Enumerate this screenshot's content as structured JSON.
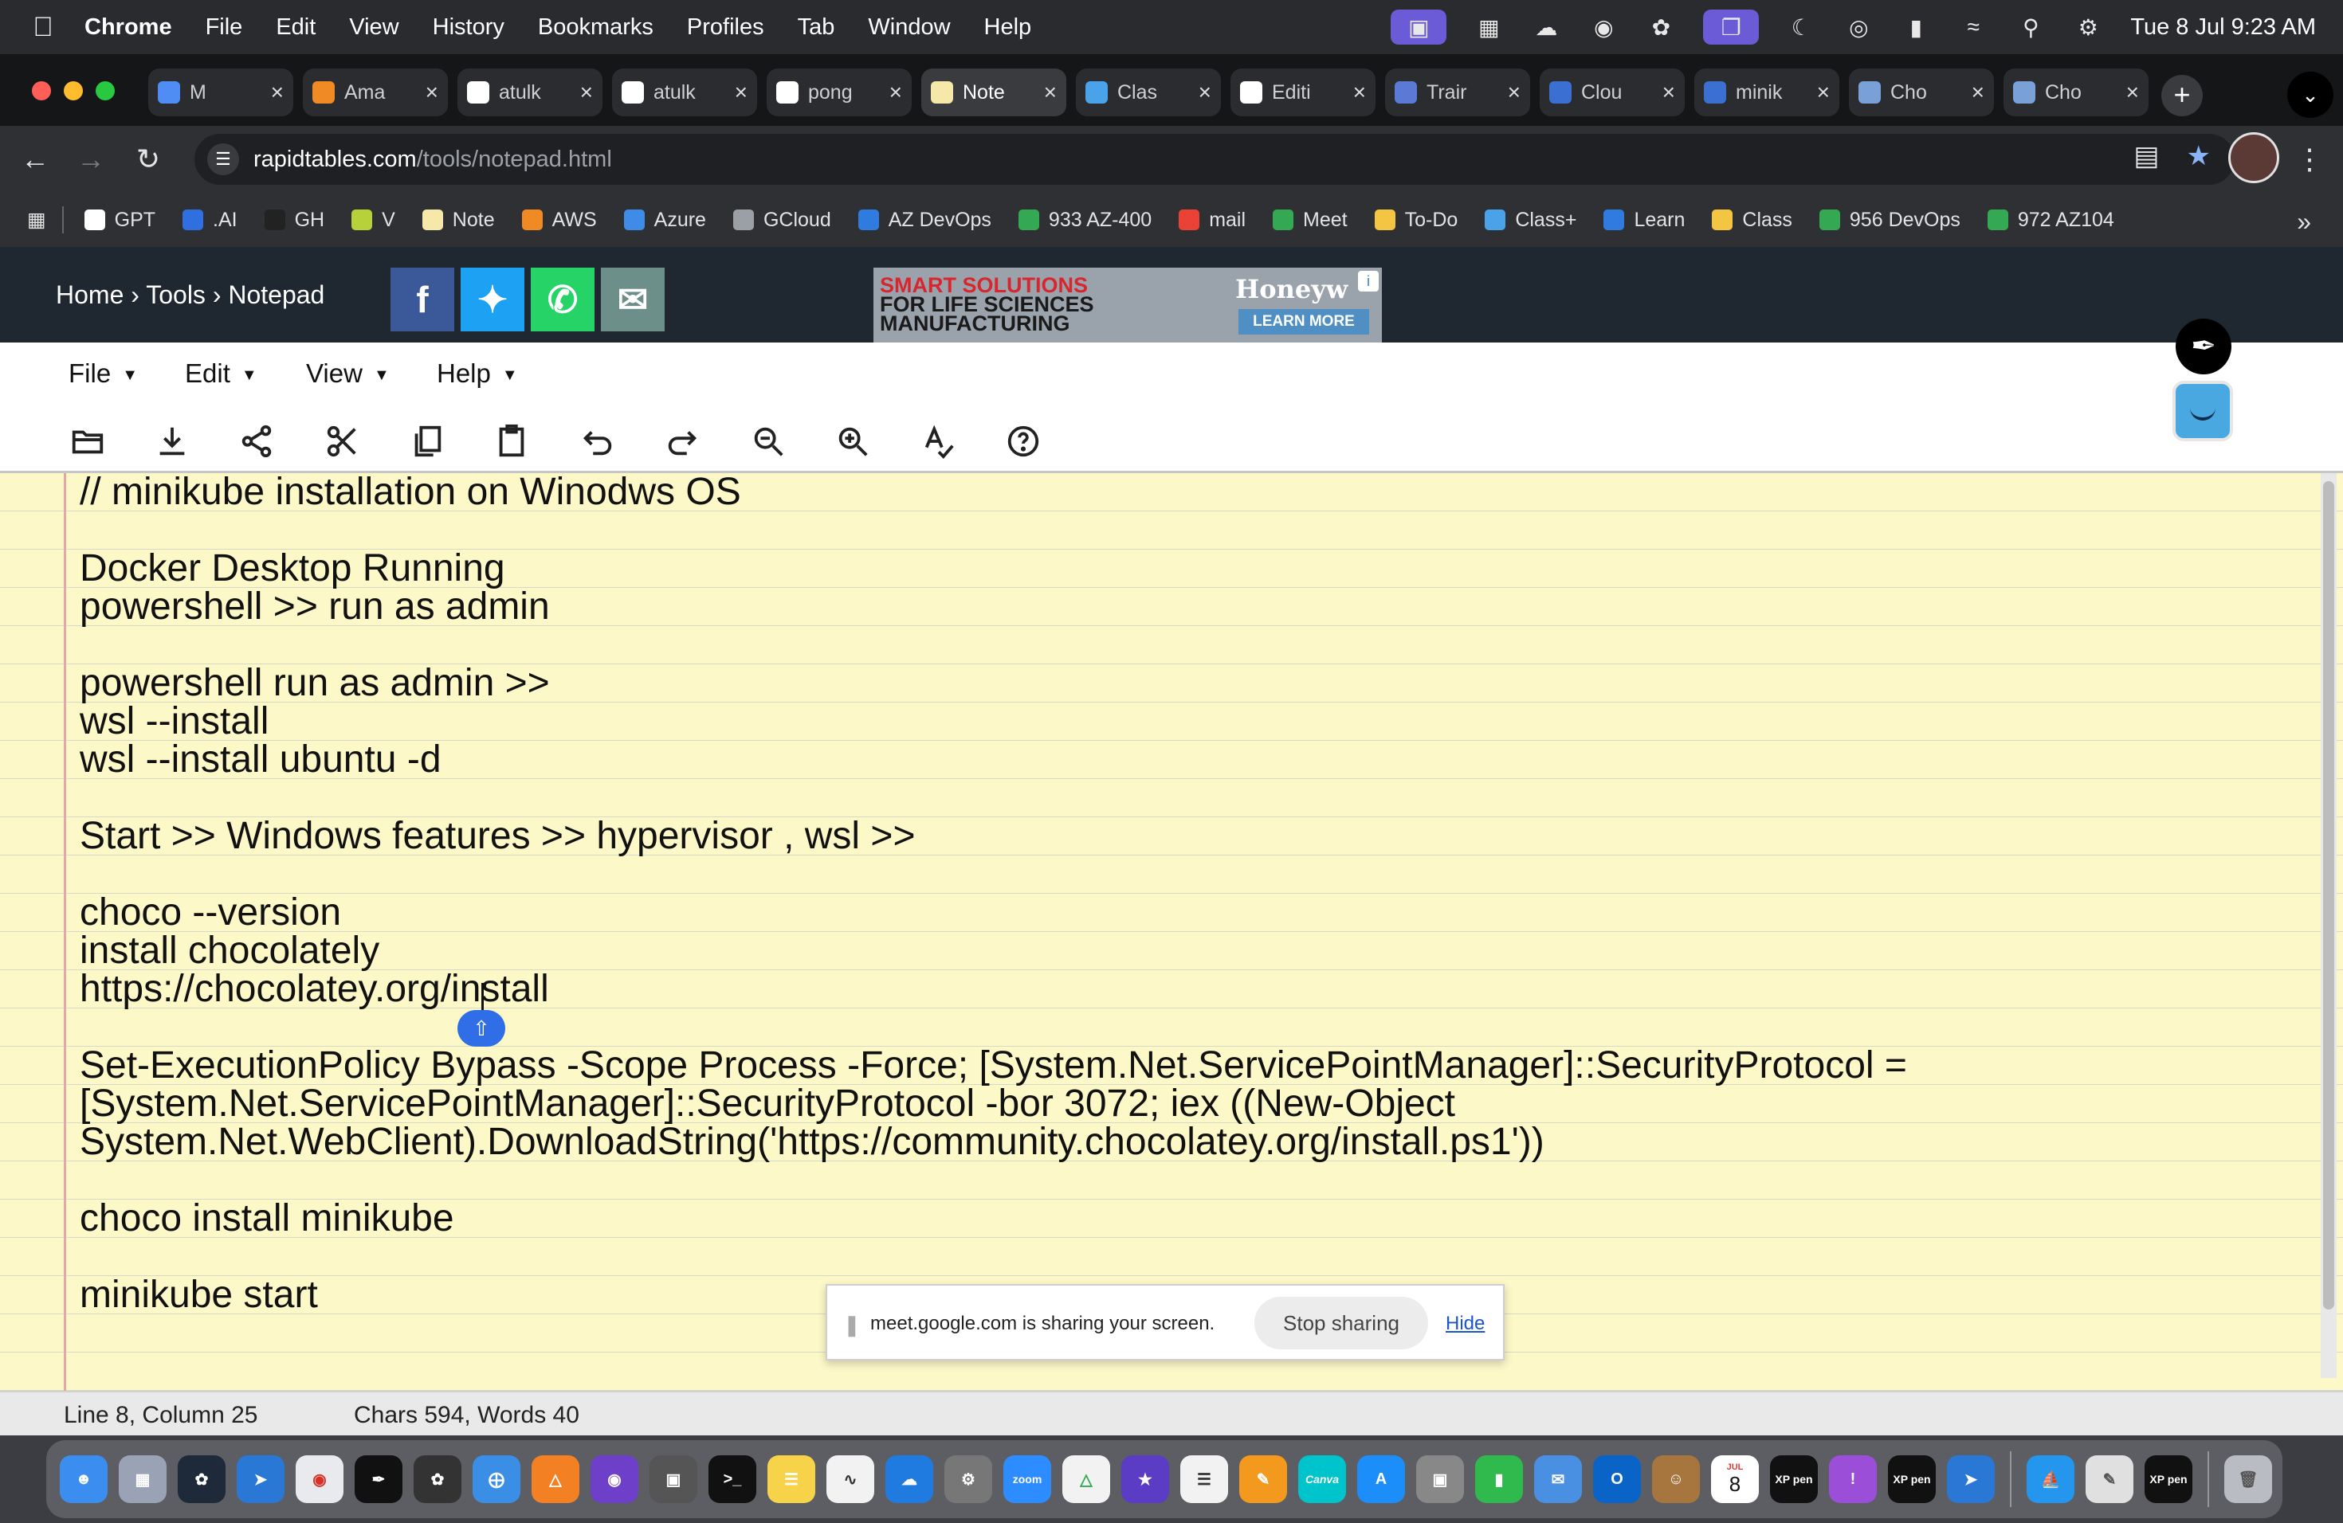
{
  "menubar": {
    "items": [
      "Chrome",
      "File",
      "Edit",
      "View",
      "History",
      "Bookmarks",
      "Profiles",
      "Tab",
      "Window",
      "Help"
    ],
    "clock": "Tue 8 Jul  9:23 AM"
  },
  "tabs": [
    {
      "label": "M",
      "color": "#4f8df5"
    },
    {
      "label": "Ama",
      "color": "#f08a24"
    },
    {
      "label": "atulk",
      "color": "#ffffff"
    },
    {
      "label": "atulk",
      "color": "#ffffff"
    },
    {
      "label": "pong",
      "color": "#ffffff"
    },
    {
      "label": "Note",
      "color": "#f5e8a8"
    },
    {
      "label": "Clas",
      "color": "#4aa3e8"
    },
    {
      "label": "Editi",
      "color": "#ffffff"
    },
    {
      "label": "Trair",
      "color": "#5a7ad6"
    },
    {
      "label": "Clou",
      "color": "#3b6fd1"
    },
    {
      "label": "minik",
      "color": "#3b6fd1"
    },
    {
      "label": "Cho",
      "color": "#7aa0d8"
    },
    {
      "label": "Cho",
      "color": "#7aa0d8"
    }
  ],
  "omnibox": {
    "domain": "rapidtables.com",
    "path": "/tools/notepad.html"
  },
  "bookmarks": [
    {
      "label": "GPT",
      "color": "#ffffff"
    },
    {
      "label": ".AI",
      "color": "#2f6fe0"
    },
    {
      "label": "GH",
      "color": "#222222"
    },
    {
      "label": "V",
      "color": "#b6d13a"
    },
    {
      "label": "Note",
      "color": "#f5e8a8"
    },
    {
      "label": "AWS",
      "color": "#f08a24"
    },
    {
      "label": "Azure",
      "color": "#3f8ce8"
    },
    {
      "label": "GCloud",
      "color": "#9aa0a6"
    },
    {
      "label": "AZ DevOps",
      "color": "#2f7be0"
    },
    {
      "label": "933 AZ-400",
      "color": "#34a853"
    },
    {
      "label": "mail",
      "color": "#ea4335"
    },
    {
      "label": "Meet",
      "color": "#34a853"
    },
    {
      "label": "To-Do",
      "color": "#f4c542"
    },
    {
      "label": "Class+",
      "color": "#4aa3e8"
    },
    {
      "label": "Learn",
      "color": "#2f7be0"
    },
    {
      "label": "Class",
      "color": "#f4c542"
    },
    {
      "label": "956 DevOps",
      "color": "#34a853"
    },
    {
      "label": "972 AZ104",
      "color": "#34a853"
    }
  ],
  "site": {
    "breadcrumb": "Home › Tools › Notepad",
    "ad_line1": "SMART SOLUTIONS",
    "ad_line2": "FOR LIFE SCIENCES",
    "ad_line3": "MANUFACTURING",
    "ad_brand": "Honeyw",
    "ad_cta": "LEARN MORE"
  },
  "notepad": {
    "menus": [
      "File",
      "Edit",
      "View",
      "Help"
    ],
    "lines": [
      "// minikube installation on Winodws OS",
      "",
      "Docker Desktop Running",
      "powershell >> run as admin",
      "",
      "powershell run as admin >>",
      "wsl --install",
      "wsl --install ubuntu -d ",
      "",
      "Start >> Windows features >> hypervisor , wsl >>",
      "",
      "choco --version",
      "install chocolately",
      "https://chocolatey.org/install",
      "",
      "Set-ExecutionPolicy Bypass -Scope Process -Force; [System.Net.ServicePointManager]::SecurityProtocol = ",
      "[System.Net.ServicePointManager]::SecurityProtocol -bor 3072; iex ((New-Object ",
      "System.Net.WebClient).DownloadString('https://community.chocolatey.org/install.ps1'))",
      "",
      "choco install minikube",
      "",
      "minikube start"
    ],
    "status_position": "Line 8, Column 25",
    "status_counts": "Chars 594, Words 40"
  },
  "share_banner": {
    "message": "meet.google.com is sharing your screen.",
    "stop_label": "Stop sharing",
    "hide_label": "Hide"
  },
  "dock": {
    "calendar_day": "8",
    "calendar_month": "JUL",
    "xp_label": "XP pen",
    "zoom_label": "zoom",
    "canva_label": "Canva"
  }
}
